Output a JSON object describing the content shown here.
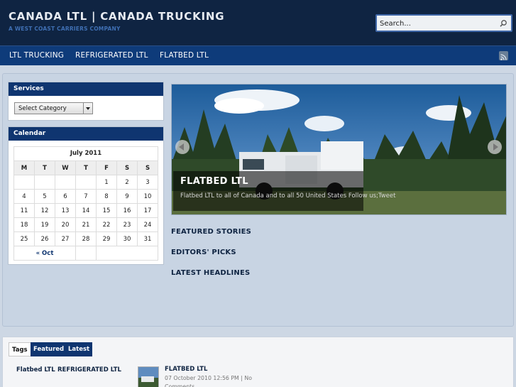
{
  "header": {
    "title": "CANADA LTL | CANADA TRUCKING",
    "tagline": "A WEST COAST CARRIERS COMPANY",
    "search_placeholder": "Search..."
  },
  "nav": {
    "items": [
      "LTL TRUCKING",
      "REFRIGERATED LTL",
      "FLATBED LTL"
    ]
  },
  "services": {
    "title": "Services",
    "select_value": "Select Category"
  },
  "calendar": {
    "title": "Calendar",
    "month": "July 2011",
    "days": [
      "M",
      "T",
      "W",
      "T",
      "F",
      "S",
      "S"
    ],
    "weeks": [
      [
        "",
        "",
        "",
        "",
        "1",
        "2",
        "3"
      ],
      [
        "4",
        "5",
        "6",
        "7",
        "8",
        "9",
        "10"
      ],
      [
        "11",
        "12",
        "13",
        "14",
        "15",
        "16",
        "17"
      ],
      [
        "18",
        "19",
        "20",
        "21",
        "22",
        "23",
        "24"
      ],
      [
        "25",
        "26",
        "27",
        "28",
        "29",
        "30",
        "31"
      ]
    ],
    "prev_link": "« Oct"
  },
  "slider": {
    "title": "FLATBED LTL",
    "text": "Flatbed LTL to all of Canada and to all 50 United States Follow us;Tweet"
  },
  "sections": [
    "FEATURED STORIES",
    "EDITORS' PICKS",
    "LATEST HEADLINES"
  ],
  "bottom": {
    "tabs": [
      "Tags",
      "Featured",
      "Latest"
    ],
    "tags": [
      "Flatbed LTL",
      "REFRIGERATED LTL"
    ],
    "post": {
      "title": "FLATBED LTL",
      "meta": "07 October 2010 12:56 PM | No Comments"
    }
  },
  "colors": {
    "header_bg": "#0f2442",
    "nav_bg": "#0e3b7a",
    "widget_title_bg": "#0f3570",
    "page_bg": "#cdd7e4"
  },
  "icons": {
    "search": "magnifier-icon",
    "rss": "rss-icon",
    "slider_prev": "arrow-left-icon",
    "slider_next": "arrow-right-icon"
  }
}
